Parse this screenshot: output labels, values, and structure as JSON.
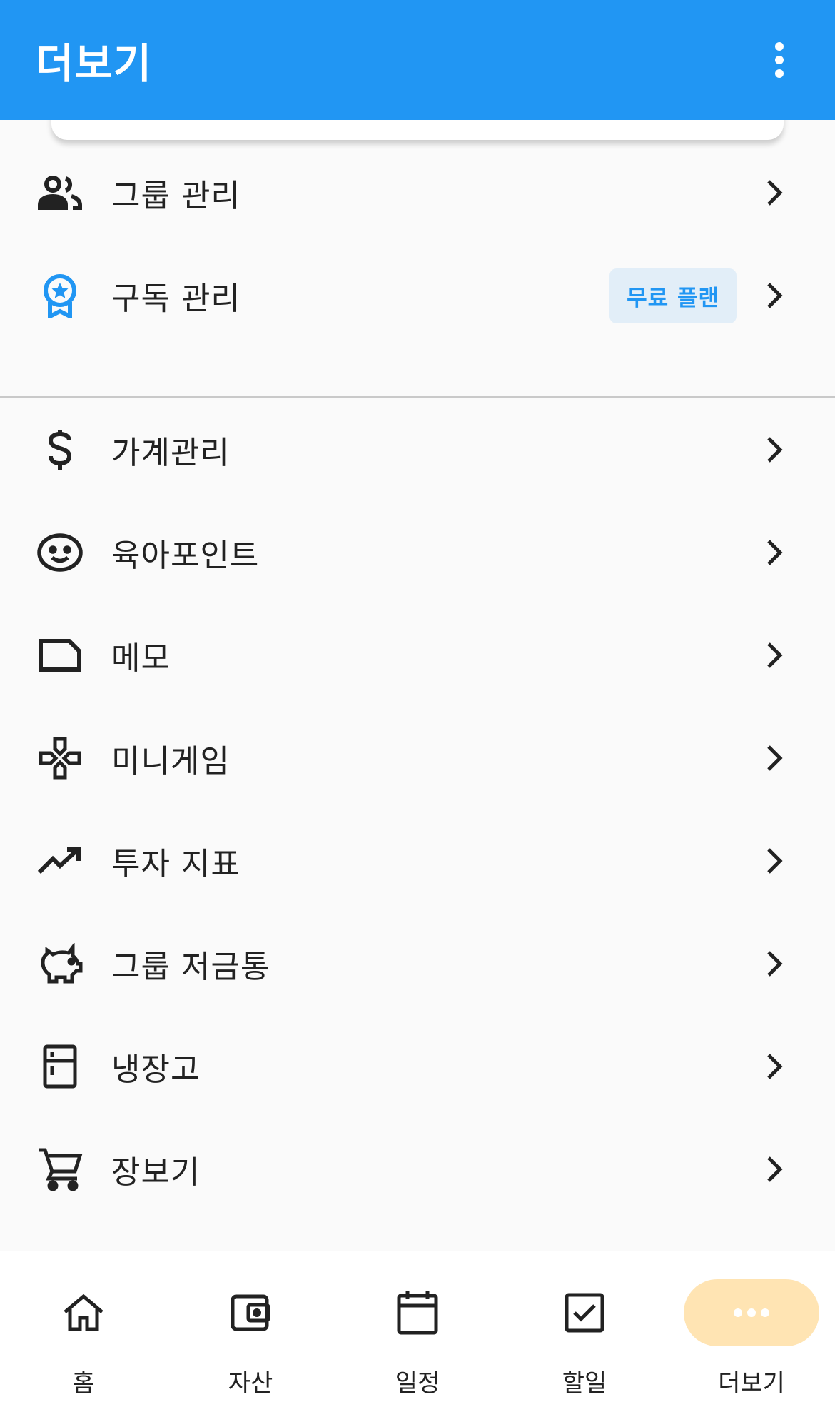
{
  "appbar": {
    "title": "더보기",
    "menu_icon": "more-vert-icon"
  },
  "menu_top": [
    {
      "label": "그룹 관리",
      "icon": "group-icon"
    },
    {
      "label": "구독 관리",
      "icon": "badge-star-icon",
      "badge": "무료 플랜"
    }
  ],
  "menu_bottom": [
    {
      "label": "가계관리",
      "icon": "dollar-icon"
    },
    {
      "label": "육아포인트",
      "icon": "baby-face-icon"
    },
    {
      "label": "메모",
      "icon": "note-icon"
    },
    {
      "label": "미니게임",
      "icon": "gamepad-icon"
    },
    {
      "label": "투자 지표",
      "icon": "trending-up-icon"
    },
    {
      "label": "그룹 저금통",
      "icon": "piggy-bank-icon"
    },
    {
      "label": "냉장고",
      "icon": "fridge-icon"
    },
    {
      "label": "장보기",
      "icon": "cart-icon"
    }
  ],
  "nav": [
    {
      "label": "홈",
      "icon": "home-icon"
    },
    {
      "label": "자산",
      "icon": "wallet-icon"
    },
    {
      "label": "일정",
      "icon": "calendar-icon"
    },
    {
      "label": "할일",
      "icon": "checkbox-icon"
    },
    {
      "label": "더보기",
      "icon": "more-horiz-icon",
      "active": true
    }
  ],
  "colors": {
    "primary": "#2196f3",
    "badge_bg": "#e2eef8",
    "active_nav_bg": "#ffe4b3"
  }
}
